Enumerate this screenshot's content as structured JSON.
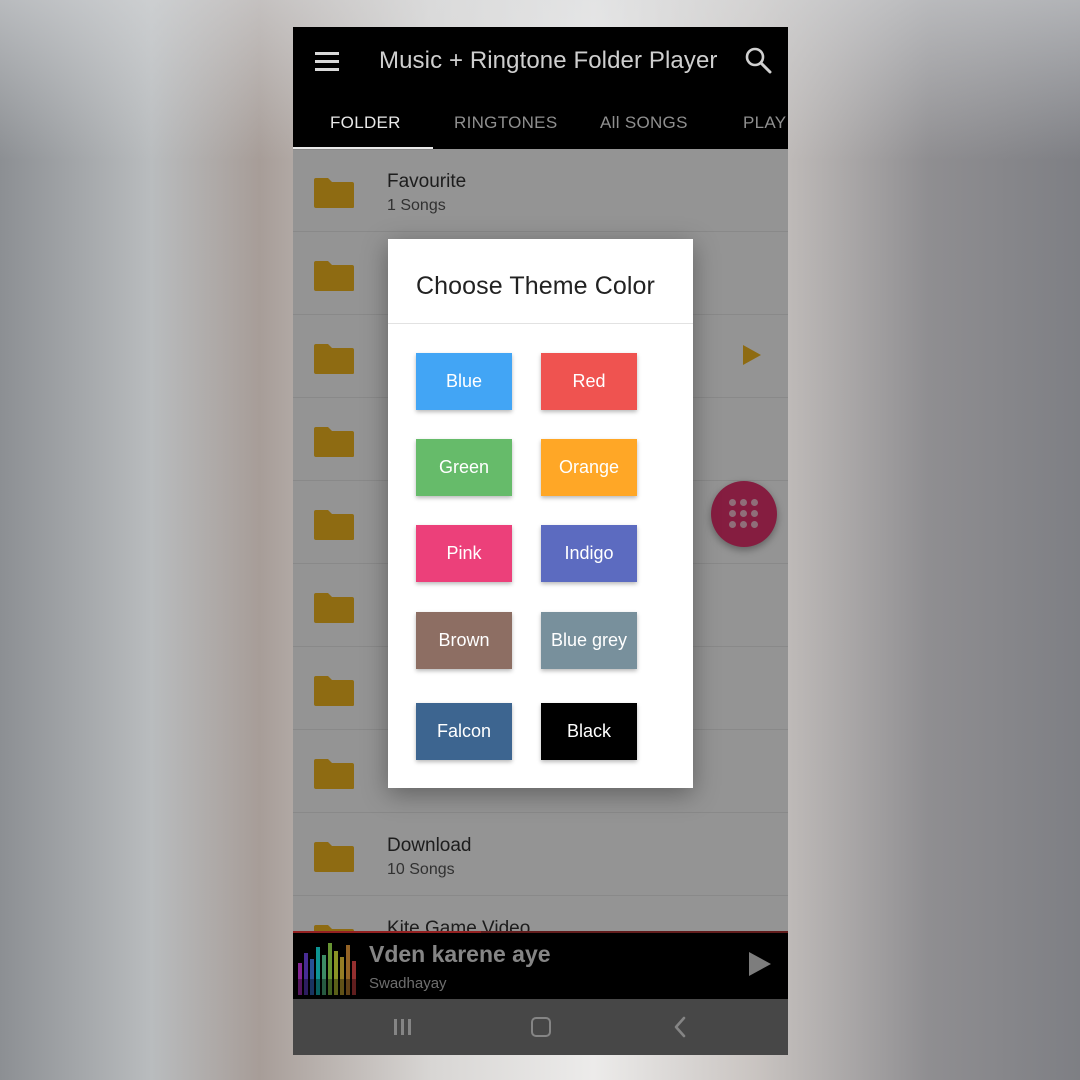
{
  "app": {
    "title": "Music + Ringtone Folder Player"
  },
  "tabs": [
    {
      "label": "FOLDER",
      "active": true
    },
    {
      "label": "RINGTONES",
      "active": false
    },
    {
      "label": "All SONGS",
      "active": false
    },
    {
      "label": "PLAY",
      "active": false
    }
  ],
  "folders": [
    {
      "title": "Favourite",
      "subtitle": "1   Songs"
    },
    {
      "title": "",
      "subtitle": ""
    },
    {
      "title": "",
      "subtitle": ""
    },
    {
      "title": "",
      "subtitle": ""
    },
    {
      "title": "",
      "subtitle": ""
    },
    {
      "title": "",
      "subtitle": ""
    },
    {
      "title": "",
      "subtitle": ""
    },
    {
      "title": "",
      "subtitle": ""
    },
    {
      "title": "Download",
      "subtitle": "10 Songs"
    },
    {
      "title": "Kite Game Video",
      "subtitle": ""
    }
  ],
  "dialog": {
    "title": "Choose Theme Color",
    "options": [
      {
        "label": "Blue",
        "color": "#42a5f5"
      },
      {
        "label": "Red",
        "color": "#ef5350"
      },
      {
        "label": "Green",
        "color": "#66bb6a"
      },
      {
        "label": "Orange",
        "color": "#ffa726"
      },
      {
        "label": "Pink",
        "color": "#ec407a"
      },
      {
        "label": "Indigo",
        "color": "#5c6bc0"
      },
      {
        "label": "Brown",
        "color": "#8d6e63"
      },
      {
        "label": "Blue grey",
        "color": "#78909c"
      },
      {
        "label": "Falcon",
        "color": "#3d6590"
      },
      {
        "label": "Black",
        "color": "#000000"
      }
    ]
  },
  "player": {
    "title": "Vden karene aye",
    "artist": "Swadhayay",
    "progress_fraction": 0.38
  },
  "colors": {
    "folder": "#f5b820",
    "fab": "#e5336e",
    "appbar": "#000000"
  }
}
